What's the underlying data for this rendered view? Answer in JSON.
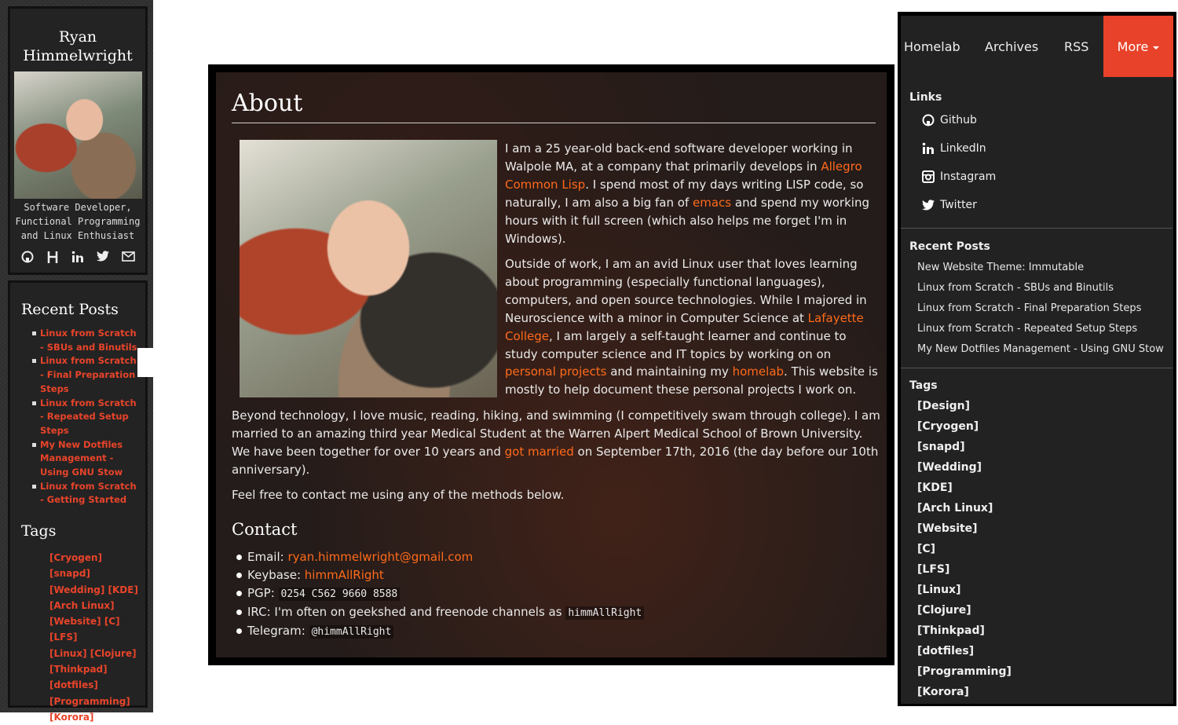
{
  "left_sidebar": {
    "author_name_line1": "Ryan",
    "author_name_line2": "Himmelwright",
    "tagline_line1": "Software Developer,",
    "tagline_line2": "Functional Programming",
    "tagline_line3": "and Linux Enthusiast",
    "social_icons": [
      "github-icon",
      "hackaday-icon",
      "linkedin-icon",
      "twitter-icon",
      "email-icon"
    ],
    "recent_posts_heading": "Recent Posts",
    "recent_posts": [
      {
        "line1": "Linux from Scratch",
        "line2": "- SBUs and Binutils",
        "line3": ""
      },
      {
        "line1": "Linux from Scratch",
        "line2": "- Final Preparation",
        "line3": "Steps"
      },
      {
        "line1": "Linux from Scratch",
        "line2": "- Repeated Setup",
        "line3": "Steps"
      },
      {
        "line1": "My New Dotfiles",
        "line2": "Management -",
        "line3": "Using GNU Stow"
      },
      {
        "line1": "Linux from Scratch",
        "line2": "- Getting Started",
        "line3": ""
      }
    ],
    "tags_heading": "Tags",
    "tag_lines": [
      "[Cryogen] [snapd]",
      "[Wedding] [KDE]",
      "[Arch Linux]",
      "[Website] [C] [LFS]",
      "[Linux] [Clojure]",
      "[Thinkpad]",
      "[dotfiles]",
      "[Programming]",
      "[Korora]"
    ]
  },
  "main": {
    "title": "About",
    "para1": {
      "t1": "I am a 25 year-old back-end software developer working in Walpole MA, at a company that primarily develops in ",
      "link1": "Allegro Common Lisp",
      "t2": ". I spend most of my days writing LISP code, so naturally, I am also a big fan of ",
      "link2": "emacs",
      "t3": " and spend my working hours with it full screen (which also helps me forget I'm in Windows)."
    },
    "para2": {
      "t1": "Outside of work, I am an avid Linux user that loves learning about programming (especially functional languages), computers, and open source technologies. While I majored in Neuroscience with a minor in Computer Science at ",
      "link1": "Lafayette College",
      "t2": ", I am largely a self-taught learner and continue to study computer science and IT topics by working on on ",
      "link2": "personal projects",
      "t3": " and maintaining my ",
      "link3": "homelab",
      "t4": ". This website is mostly to help document these personal projects I work on."
    },
    "para3": {
      "t1": "Beyond technology, I love music, reading, hiking, and swimming (I competitively swam through college). I am married to an amazing third year Medical Student at the Warren Alpert Medical School of Brown University. We have been together for over 10 years and ",
      "link1": "got married",
      "t2": " on September 17th, 2016 (the day before our 10th anniversary)."
    },
    "para4": "Feel free to contact me using any of the methods below.",
    "contact_heading": "Contact",
    "contact": {
      "email_label": "Email: ",
      "email_value": "ryan.himmelwright@gmail.com",
      "keybase_label": "Keybase: ",
      "keybase_value": "himmAllRight",
      "pgp_label": "PGP: ",
      "pgp_value": "0254 C562 9660 8588",
      "irc_label": "IRC: I'm often on geekshed and freenode channels as ",
      "irc_value": "himmAllRight",
      "telegram_label": "Telegram: ",
      "telegram_value": "@himmAllRight"
    }
  },
  "right_sidebar": {
    "nav": {
      "homelab": "Homelab",
      "archives": "Archives",
      "rss": "RSS",
      "more": "More"
    },
    "links_heading": "Links",
    "links": [
      {
        "label": "Github",
        "icon": "github-icon"
      },
      {
        "label": "LinkedIn",
        "icon": "linkedin-icon"
      },
      {
        "label": "Instagram",
        "icon": "instagram-icon"
      },
      {
        "label": "Twitter",
        "icon": "twitter-icon"
      }
    ],
    "recent_posts_heading": "Recent Posts",
    "recent_posts": [
      "New Website Theme: Immutable",
      "Linux from Scratch - SBUs and Binutils",
      "Linux from Scratch - Final Preparation Steps",
      "Linux from Scratch - Repeated Setup Steps",
      "My New Dotfiles Management - Using GNU Stow"
    ],
    "tags_heading": "Tags",
    "tags": [
      "[Design]",
      "[Cryogen]",
      "[snapd]",
      "[Wedding]",
      "[KDE]",
      "[Arch Linux]",
      "[Website]",
      "[C]",
      "[LFS]",
      "[Linux]",
      "[Clojure]",
      "[Thinkpad]",
      "[dotfiles]",
      "[Programming]",
      "[Korora]"
    ]
  },
  "colors": {
    "accent": "#e8432a",
    "link": "#ff6a1a",
    "panel_bg": "#222222"
  }
}
